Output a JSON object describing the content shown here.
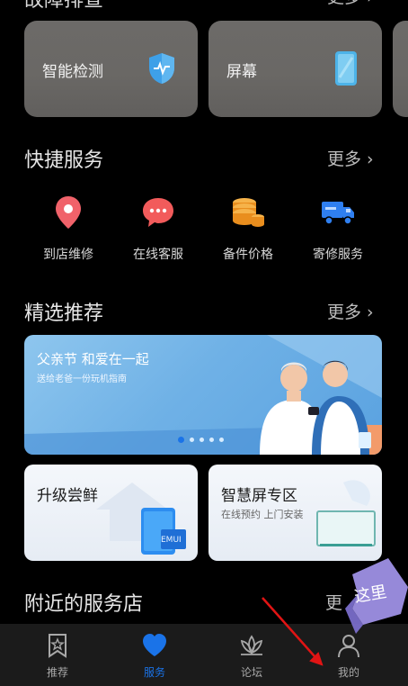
{
  "top_section": {
    "title": "故障排查",
    "more": "更多"
  },
  "diagnostics": [
    {
      "label": "智能检测",
      "icon": "shield-pulse-icon"
    },
    {
      "label": "屏幕",
      "icon": "phone-screen-icon"
    }
  ],
  "quick_services": {
    "title": "快捷服务",
    "more": "更多",
    "items": [
      {
        "label": "到店维修",
        "icon": "location-pin-icon",
        "color": "#f0626a"
      },
      {
        "label": "在线客服",
        "icon": "chat-bubble-icon",
        "color": "#f25b5b"
      },
      {
        "label": "备件价格",
        "icon": "coins-icon",
        "color": "#f39a2b"
      },
      {
        "label": "寄修服务",
        "icon": "delivery-truck-icon",
        "color": "#2f7ff0"
      }
    ]
  },
  "featured": {
    "title": "精选推荐",
    "more": "更多",
    "banner": {
      "title": "父亲节 和爱在一起",
      "subtitle": "送给老爸一份玩机指南",
      "dots": 5,
      "active_dot": 1
    },
    "cards": [
      {
        "title": "升级尝鲜",
        "subtitle": "",
        "badge": "EMUI"
      },
      {
        "title": "智慧屏专区",
        "subtitle": "在线预约 上门安装"
      }
    ]
  },
  "nearby": {
    "title": "附近的服务店",
    "more": "更"
  },
  "annotation": {
    "text": "这里"
  },
  "tabbar": {
    "active": "服务",
    "items": [
      {
        "label": "推荐",
        "icon": "bookmark-star-icon"
      },
      {
        "label": "服务",
        "icon": "heart-icon"
      },
      {
        "label": "论坛",
        "icon": "lotus-icon"
      },
      {
        "label": "我的",
        "icon": "person-icon"
      }
    ]
  },
  "colors": {
    "accent": "#1a73e8",
    "background": "#000000",
    "tabbar": "#1b1b1b",
    "annotation": "#9b8ee8"
  }
}
